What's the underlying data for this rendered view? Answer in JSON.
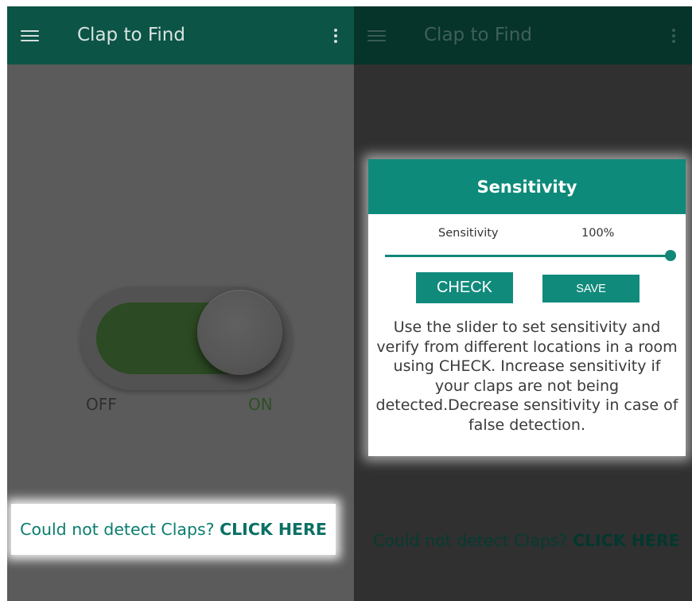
{
  "app": {
    "title": "Clap to Find",
    "menu_icon": "hamburger-menu-icon",
    "overflow_icon": "more-vert-icon"
  },
  "toggle": {
    "state": "on",
    "off_label": "OFF",
    "on_label": "ON"
  },
  "help_link": {
    "prefix": "Could not detect Claps? ",
    "action": "CLICK HERE"
  },
  "dialog": {
    "title": "Sensitivity",
    "sensitivity_label": "Sensitivity",
    "sensitivity_value": "100%",
    "slider_level_percent": 100,
    "check_label": "CHECK",
    "save_label": "SAVE",
    "description": "Use the slider to set sensitivity and verify from different locations in a room using CHECK. Increase sensitivity if your claps are not being detected.Decrease sensitivity in case of false detection."
  },
  "colors": {
    "accent": "#0d8a7a",
    "appbar": "#0c5446",
    "link": "#0a7d6e"
  }
}
